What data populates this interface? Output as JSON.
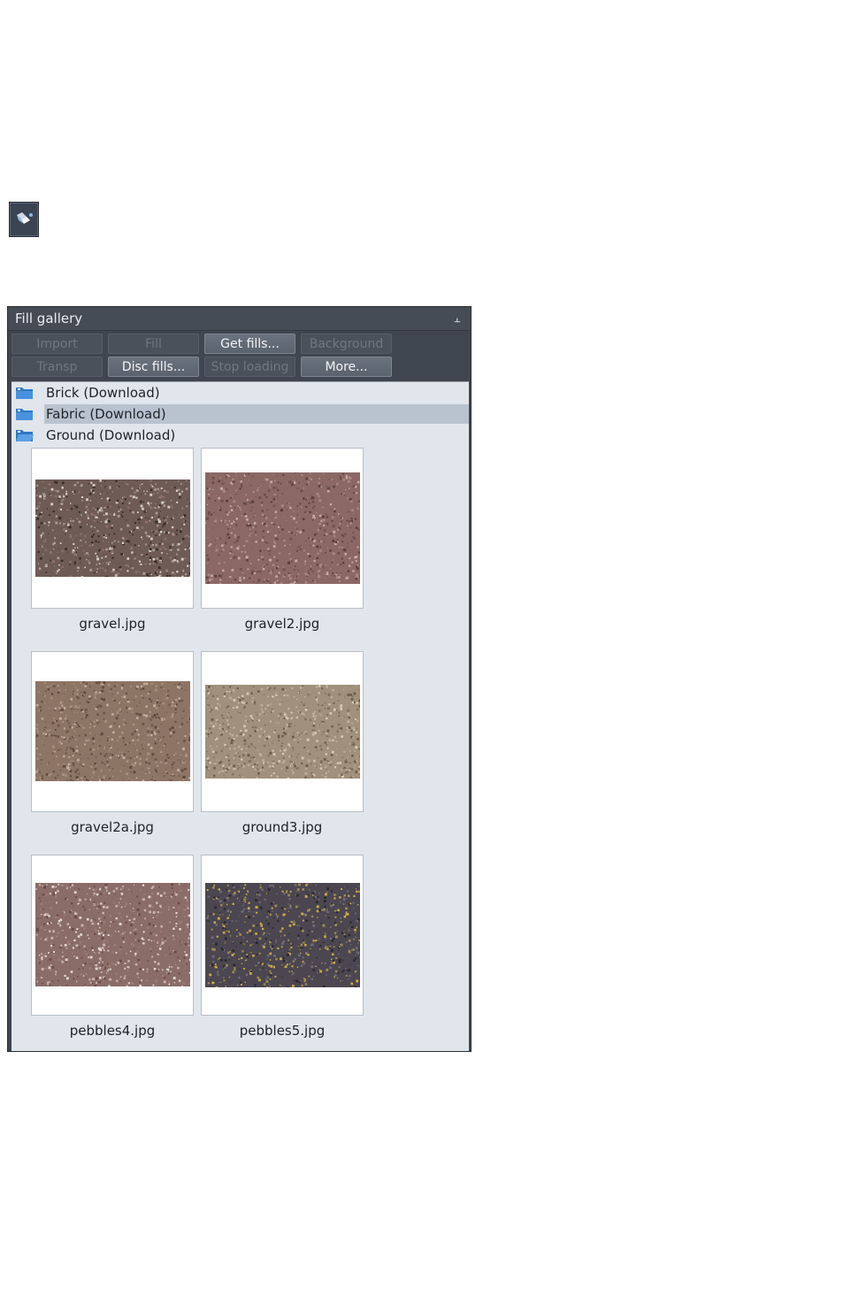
{
  "toolbar_icon": {
    "name": "fill-tool-icon"
  },
  "panel": {
    "title": "Fill gallery",
    "pin_glyph": "⫠",
    "buttons_row1": [
      {
        "label": "Import",
        "enabled": false
      },
      {
        "label": "Fill",
        "enabled": false
      },
      {
        "label": "Get fills...",
        "enabled": true
      },
      {
        "label": "Background",
        "enabled": false
      }
    ],
    "buttons_row2": [
      {
        "label": "Transp",
        "enabled": false
      },
      {
        "label": "Disc fills...",
        "enabled": true
      },
      {
        "label": "Stop loading",
        "enabled": false
      },
      {
        "label": "More...",
        "enabled": true
      }
    ],
    "folders": [
      {
        "label": "Brick (Download)",
        "selected": false,
        "icon": "folder-closed-icon"
      },
      {
        "label": "Fabric (Download)",
        "selected": true,
        "icon": "folder-closed-icon"
      },
      {
        "label": "Ground (Download)",
        "selected": false,
        "icon": "folder-open-icon"
      }
    ],
    "items": [
      {
        "caption": "gravel.jpg",
        "base": "#6e5b55",
        "speck": [
          "#3a2e2b",
          "#a89a93",
          "#8a7169",
          "#d6ccc8"
        ]
      },
      {
        "caption": "gravel2.jpg",
        "base": "#8b6864",
        "speck": [
          "#6d4e4b",
          "#a88984",
          "#c5aaa4",
          "#5a3f3c"
        ]
      },
      {
        "caption": "gravel2a.jpg",
        "base": "#8d7566",
        "speck": [
          "#6b5648",
          "#a8907f",
          "#c2ad9d",
          "#5e4a3e"
        ]
      },
      {
        "caption": "ground3.jpg",
        "base": "#a0907c",
        "speck": [
          "#857460",
          "#bcae99",
          "#d4c8b6",
          "#6d5e4c"
        ]
      },
      {
        "caption": "pebbles4.jpg",
        "base": "#8a6c68",
        "speck": [
          "#6c4a47",
          "#c8b3b0",
          "#e2d6d4",
          "#9b7a73"
        ]
      },
      {
        "caption": "pebbles5.jpg",
        "base": "#4b4650",
        "speck": [
          "#2a2730",
          "#9a8a55",
          "#c7a94a",
          "#6d6a77"
        ]
      }
    ]
  }
}
